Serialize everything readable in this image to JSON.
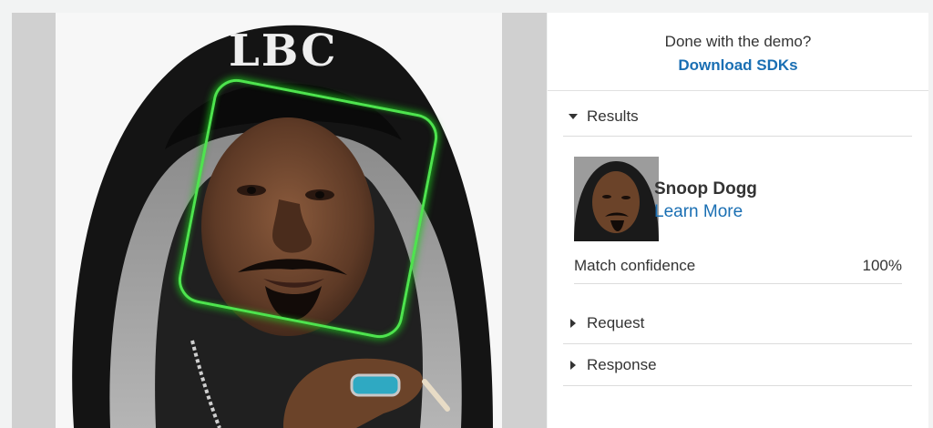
{
  "header": {
    "question": "Done with the demo?",
    "download_label": "Download SDKs"
  },
  "sections": {
    "results": "Results",
    "request": "Request",
    "response": "Response"
  },
  "result": {
    "name": "Snoop Dogg",
    "learn_more": "Learn More",
    "confidence_label": "Match confidence",
    "confidence_value": "100%"
  },
  "image": {
    "hood_text": "LBC",
    "bounding_box_color": "#4ee44e"
  },
  "colors": {
    "link": "#1a6fb3",
    "panel_bg": "#ffffff",
    "page_bg": "#f2f3f3"
  }
}
